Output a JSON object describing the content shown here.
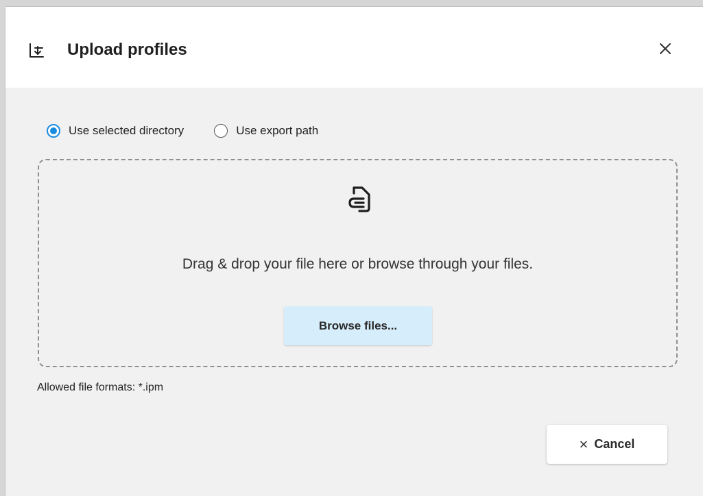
{
  "dialog": {
    "title": "Upload profiles",
    "header_icon": "upload-import-icon",
    "close_icon": "close-icon"
  },
  "radio_options": [
    {
      "label": "Use selected directory",
      "checked": true
    },
    {
      "label": "Use export path",
      "checked": false
    }
  ],
  "dropzone": {
    "icon": "attachment-file-icon",
    "text": "Drag & drop your file here or browse through your files.",
    "browse_label": "Browse files..."
  },
  "formats_text": "Allowed file formats: *.ipm",
  "footer": {
    "cancel_icon": "×",
    "cancel_label": "Cancel"
  },
  "colors": {
    "accent": "#1a8ce0",
    "browse_bg": "#d6eefb",
    "dialog_bg": "#f1f1f1",
    "header_bg": "#ffffff"
  }
}
